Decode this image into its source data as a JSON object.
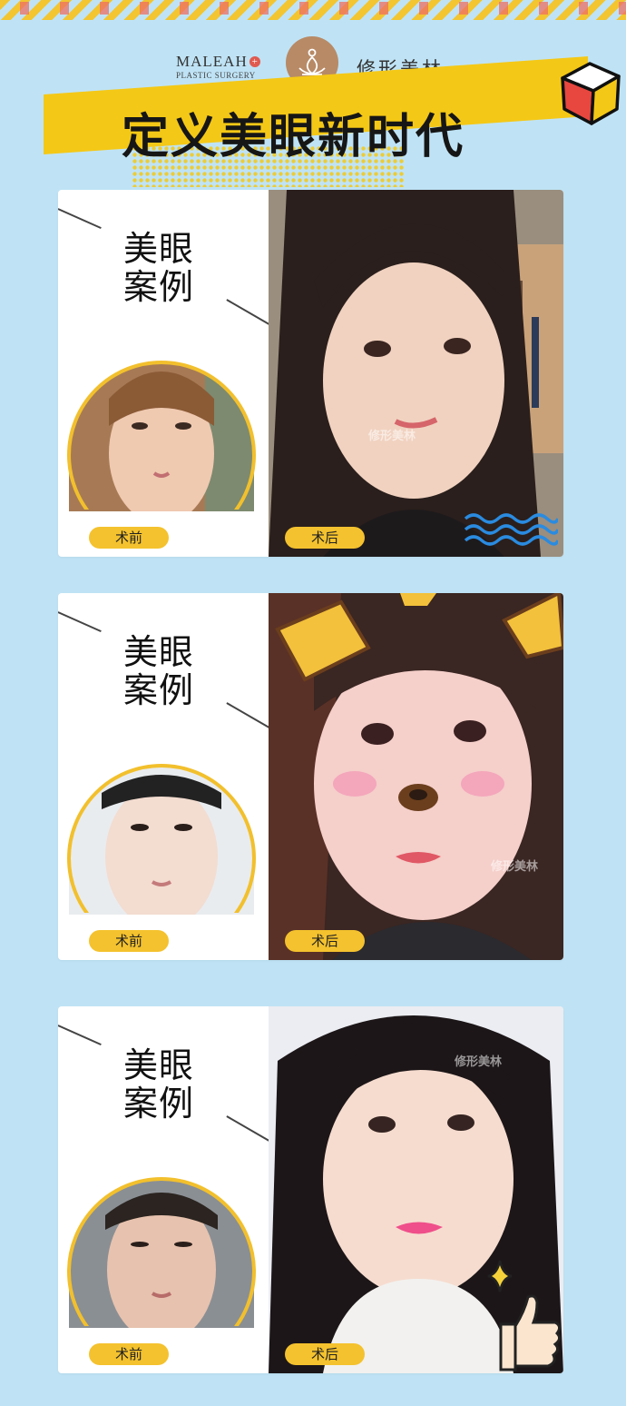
{
  "header": {
    "brand_en": "MALEAH",
    "brand_en_sub": "PLASTIC SURGERY",
    "brand_cn": "修形美林",
    "title": "定义美眼新时代"
  },
  "cases": [
    {
      "label_line1": "美眼",
      "label_line2": "案例",
      "before": "术前",
      "after": "术后"
    },
    {
      "label_line1": "美眼",
      "label_line2": "案例",
      "before": "术前",
      "after": "术后"
    },
    {
      "label_line1": "美眼",
      "label_line2": "案例",
      "before": "术前",
      "after": "术后"
    }
  ],
  "watermark": "修形美林",
  "colors": {
    "background": "#bfe3f5",
    "accent": "#f4c816",
    "pill": "#f4c22e",
    "logo": "#b88a66"
  },
  "icons": [
    "lotus-logo-icon",
    "cube-icon",
    "wave-icon",
    "sparkle-icon",
    "thumbs-up-icon"
  ]
}
